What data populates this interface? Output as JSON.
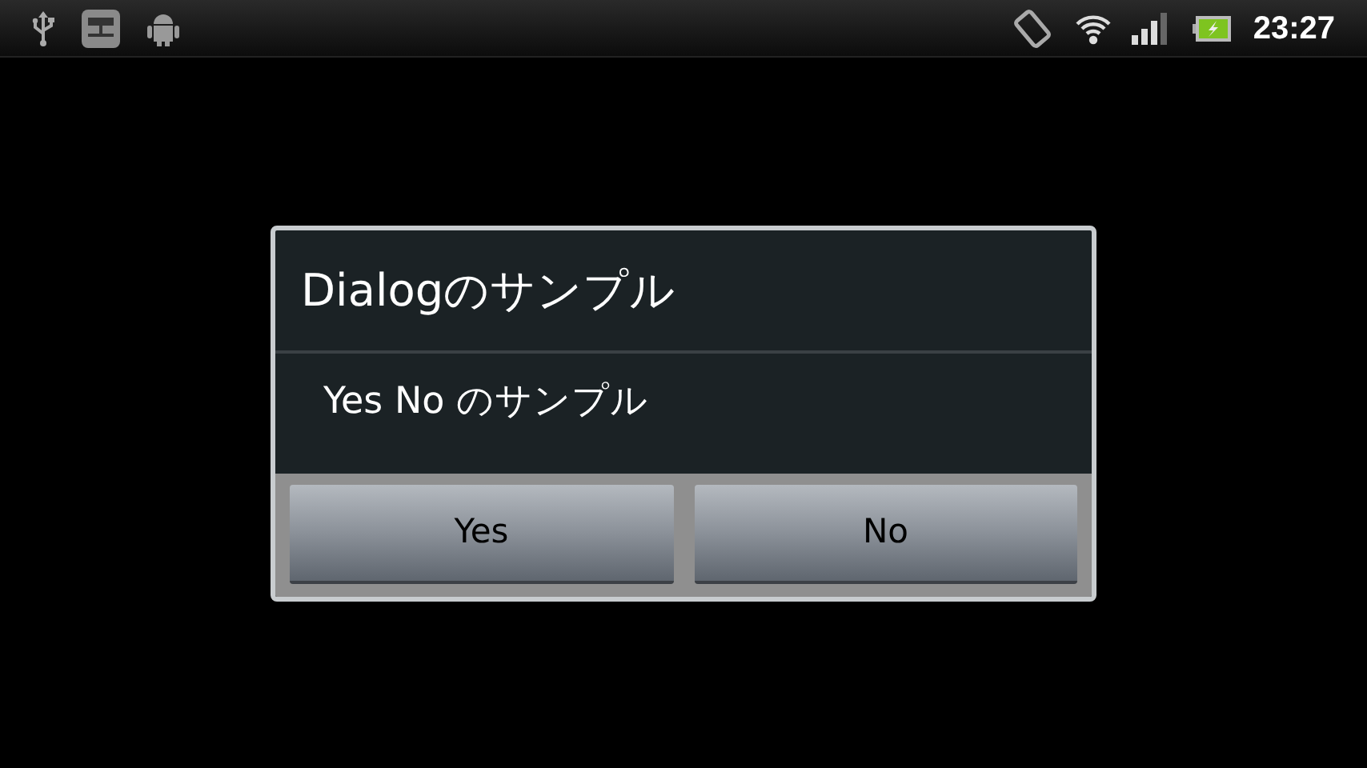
{
  "status_bar": {
    "time": "23:27"
  },
  "dialog": {
    "title": "Dialogのサンプル",
    "message": "Yes No のサンプル",
    "buttons": [
      {
        "label": "Yes"
      },
      {
        "label": "No"
      }
    ]
  }
}
